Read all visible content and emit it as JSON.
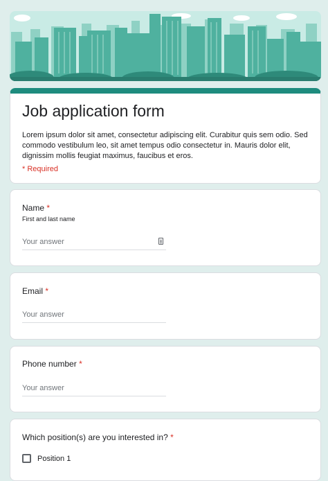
{
  "banner": {
    "image": "city-skyline-illustration"
  },
  "form": {
    "title": "Job application form",
    "description": "Lorem ipsum dolor sit amet, consectetur adipiscing elit. Curabitur quis sem odio. Sed commodo vestibulum leo, sit amet tempus odio consectetur in. Mauris dolor elit, dignissim mollis feugiat maximus, faucibus et eros.",
    "required_note": "* Required"
  },
  "questions": {
    "name": {
      "label": "Name",
      "required_mark": "*",
      "help": "First and last name",
      "placeholder": "Your answer"
    },
    "email": {
      "label": "Email",
      "required_mark": "*",
      "placeholder": "Your answer"
    },
    "phone": {
      "label": "Phone number",
      "required_mark": "*",
      "placeholder": "Your answer"
    },
    "position": {
      "label": "Which position(s) are you interested in?",
      "required_mark": "*",
      "options": [
        "Position 1"
      ]
    }
  },
  "colors": {
    "theme": "#1e8c7e",
    "background": "#dfeeec",
    "required": "#d93025"
  },
  "icons": {
    "name_field": "contact-card-icon"
  }
}
